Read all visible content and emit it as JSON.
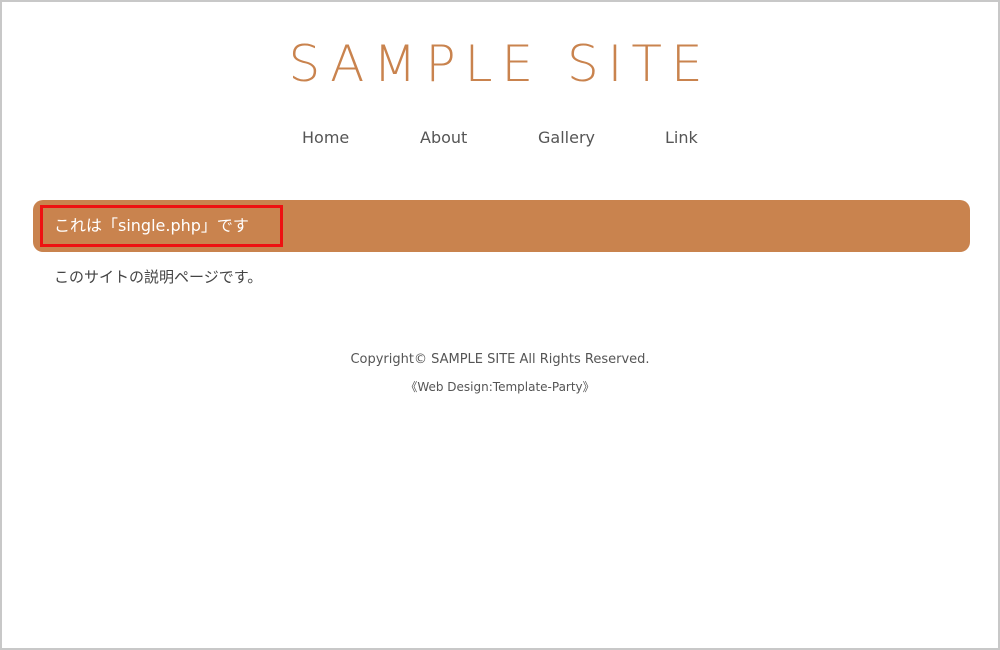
{
  "header": {
    "site_title": "SAMPLE SITE"
  },
  "nav": {
    "items": [
      "Home",
      "About",
      "Gallery",
      "Link"
    ]
  },
  "main": {
    "page_heading": "これは「single.php」です",
    "description": "このサイトの説明ページです。"
  },
  "footer": {
    "copyright": "Copyright© SAMPLE SITE All Rights Reserved.",
    "credit": "《Web Design:Template-Party》"
  },
  "colors": {
    "accent": "#c9834e",
    "highlight_border": "#ee1111",
    "frame_border": "#c8c8c8"
  }
}
